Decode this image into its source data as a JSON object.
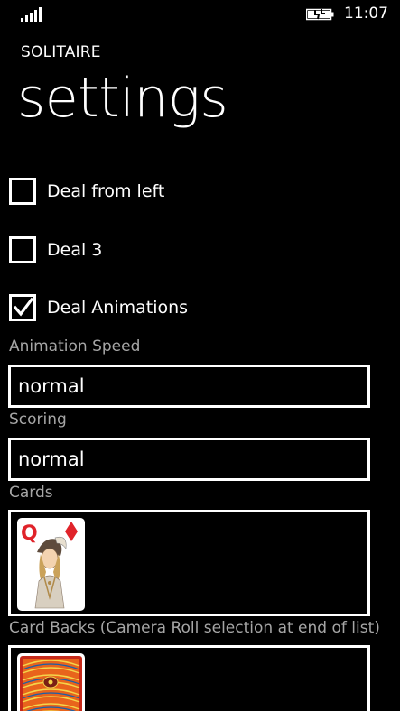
{
  "status": {
    "time": "11:07",
    "signal_icon": "signal-bars-icon",
    "battery_icon": "battery-charging-icon"
  },
  "app": {
    "name": "SOLITAIRE"
  },
  "page": {
    "title": "settings"
  },
  "options": [
    {
      "label": "Deal from left",
      "checked": false
    },
    {
      "label": "Deal 3",
      "checked": false
    },
    {
      "label": "Deal Animations",
      "checked": true
    }
  ],
  "animation_speed": {
    "label": "Animation Speed",
    "value": "normal"
  },
  "scoring": {
    "label": "Scoring",
    "value": "normal"
  },
  "cards": {
    "label": "Cards",
    "selected_rank": "Q",
    "selected_suit_color": "#e0232a"
  },
  "card_backs": {
    "label": "Card Backs (Camera Roll selection at end of list)"
  }
}
